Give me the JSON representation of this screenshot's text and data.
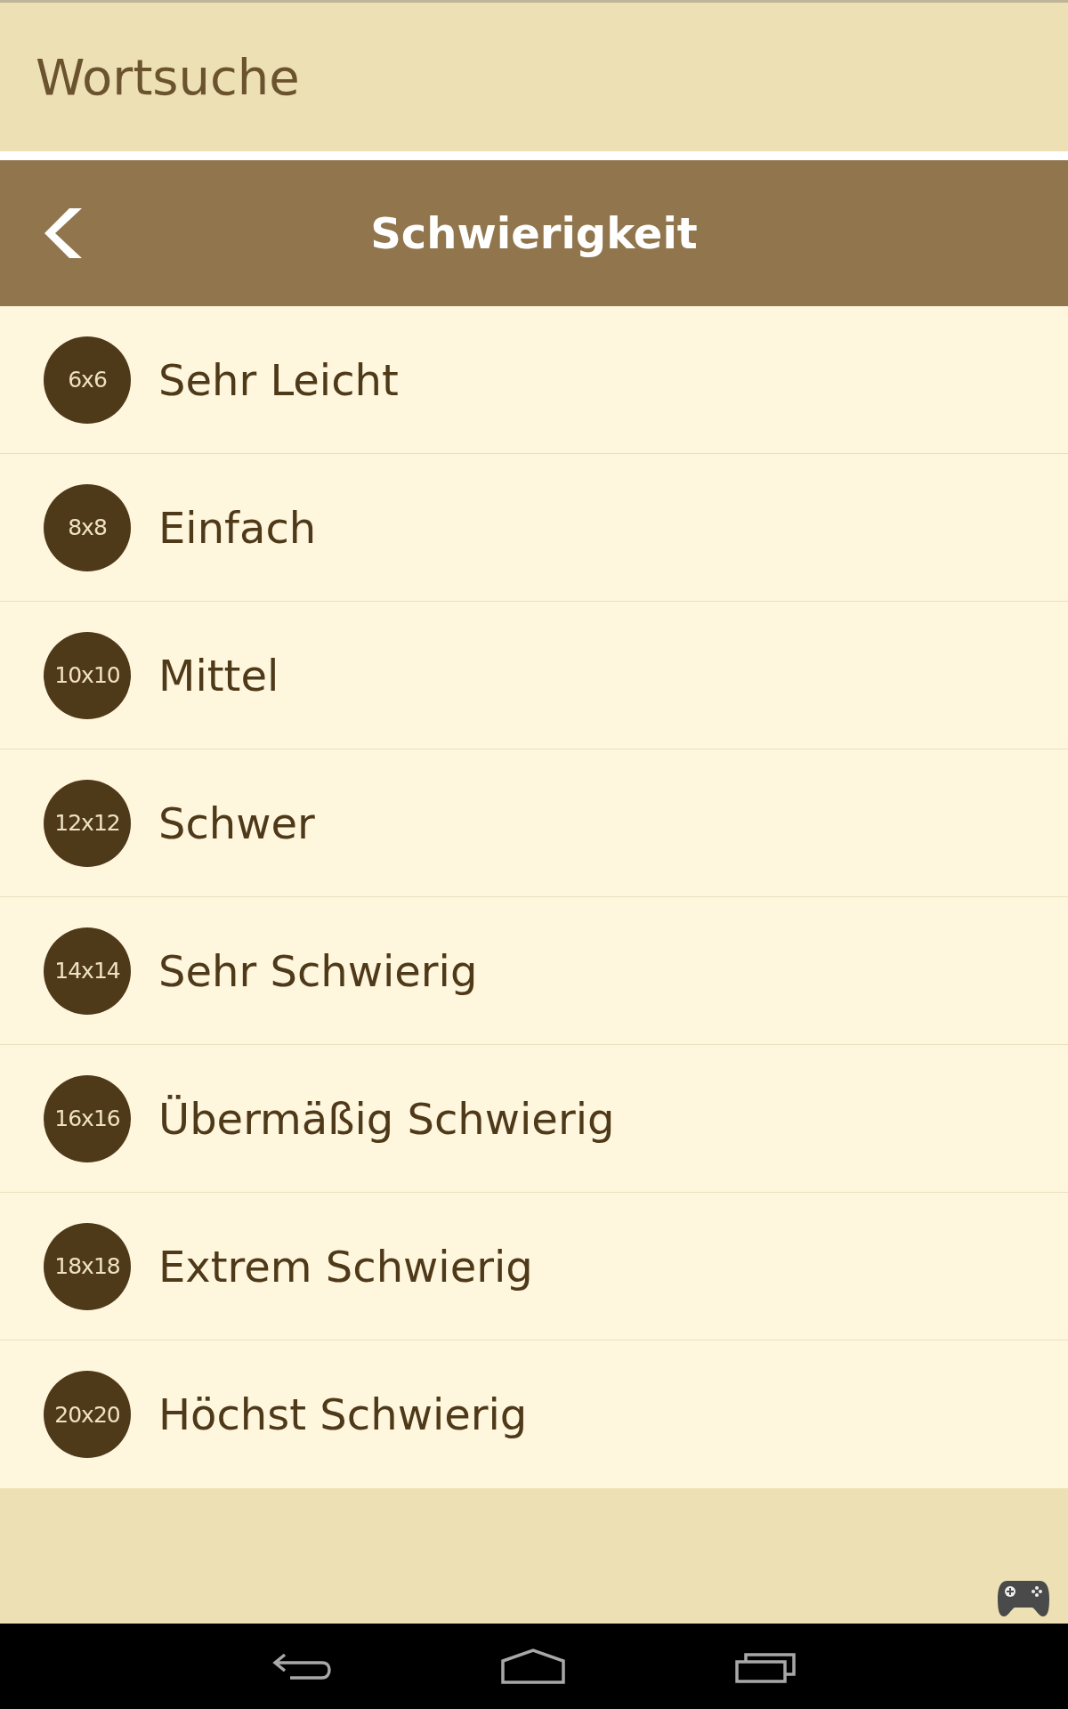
{
  "app_bar": {
    "title": "Wortsuche"
  },
  "toolbar": {
    "title": "Schwierigkeit"
  },
  "levels": [
    {
      "size": "6x6",
      "name": "Sehr Leicht"
    },
    {
      "size": "8x8",
      "name": "Einfach"
    },
    {
      "size": "10x10",
      "name": "Mittel"
    },
    {
      "size": "12x12",
      "name": "Schwer"
    },
    {
      "size": "14x14",
      "name": "Sehr Schwierig"
    },
    {
      "size": "16x16",
      "name": "Übermäßig Schwierig"
    },
    {
      "size": "18x18",
      "name": "Extrem Schwierig"
    },
    {
      "size": "20x20",
      "name": "Höchst Schwierig"
    }
  ]
}
